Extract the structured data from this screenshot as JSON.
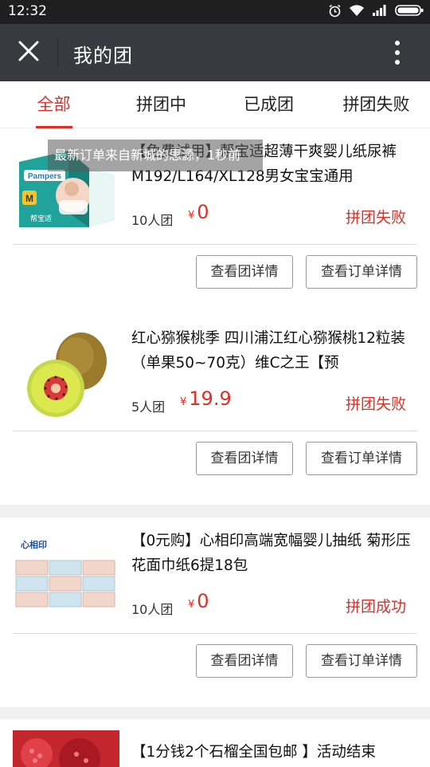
{
  "status_bar": {
    "time": "12:32"
  },
  "header": {
    "title": "我的团"
  },
  "tabs": [
    {
      "label": "全部"
    },
    {
      "label": "拼团中"
    },
    {
      "label": "已成团"
    },
    {
      "label": "拼团失败"
    }
  ],
  "toast": {
    "text": "最新订单来自新城的思源，1秒前"
  },
  "orders": [
    {
      "title": "【免费试用】帮宝适超薄干爽婴儿纸尿裤M192/L164/XL128男女宝宝通用",
      "team": "10人团",
      "currency": "¥",
      "price": "0",
      "status": "拼团失败",
      "btn_team": "查看团详情",
      "btn_order": "查看订单详情",
      "image_text": {
        "brand": "Pampers",
        "cn": "帮宝适",
        "size": "M"
      }
    },
    {
      "title": "红心猕猴桃季 四川浦江红心猕猴桃12粒装（单果50~70克）维C之王【预",
      "team": "5人团",
      "currency": "¥",
      "price": "19.9",
      "status": "拼团失败",
      "btn_team": "查看团详情",
      "btn_order": "查看订单详情"
    },
    {
      "title": "【0元购】心相印高端宽幅婴儿抽纸 菊形压花面巾纸6提18包",
      "team": "10人团",
      "currency": "¥",
      "price": "0",
      "status": "拼团成功",
      "btn_team": "查看团详情",
      "btn_order": "查看订单详情",
      "image_text": {
        "brand": "心相印"
      }
    },
    {
      "title": "【1分钱2个石榴全国包邮 】活动结束"
    }
  ],
  "colors": {
    "accent": "#e02e24",
    "appbar": "#393a3f",
    "statusbar": "#1f1f1f"
  },
  "icons": [
    "alarm-icon",
    "wifi-icon",
    "signal-icon",
    "battery-icon",
    "close-icon",
    "more-vertical-icon"
  ]
}
